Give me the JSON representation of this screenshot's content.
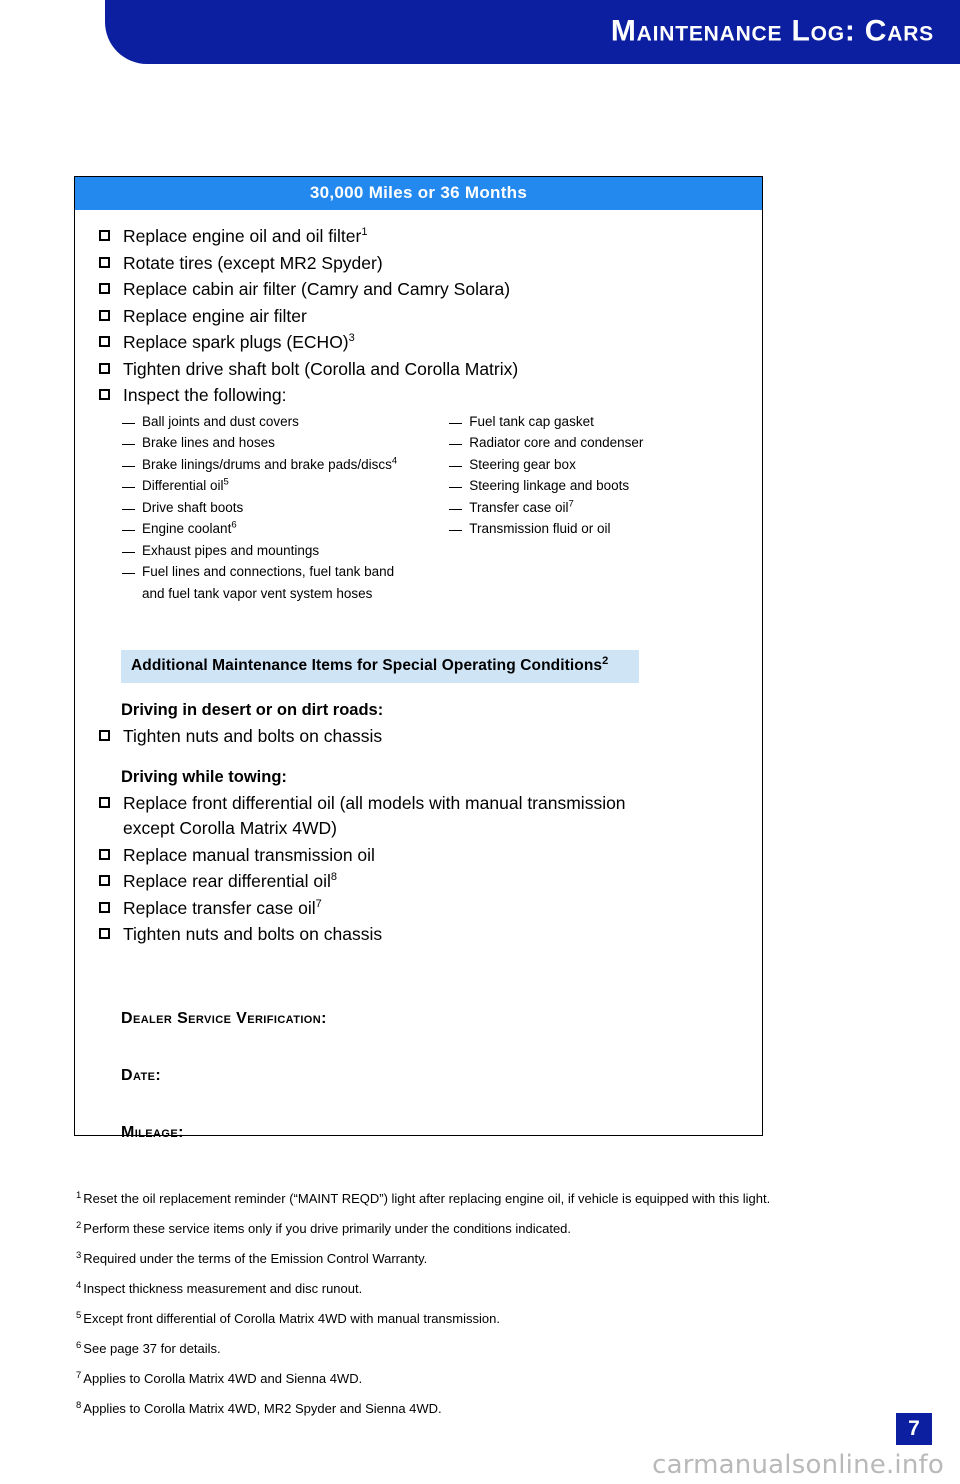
{
  "header": {
    "title": "Maintenance Log: Cars",
    "banner_color": "#0b1fa0"
  },
  "log_table": {
    "header_title": "30,000 Miles or 36 Months",
    "header_color": "#2389ef",
    "items": [
      {
        "label": "Replace engine oil and oil filter",
        "sup": "1"
      },
      {
        "label": "Rotate tires (except MR2 Spyder)",
        "sup": ""
      },
      {
        "label": "Replace cabin air filter (Camry and Camry Solara)",
        "sup": ""
      },
      {
        "label": "Replace engine air filter",
        "sup": ""
      },
      {
        "label": "Replace spark plugs (ECHO)",
        "sup": "3"
      },
      {
        "label": "Tighten drive shaft bolt (Corolla and Corolla Matrix)",
        "sup": ""
      },
      {
        "label": "Inspect the following:",
        "sup": ""
      }
    ],
    "inspect_left": [
      {
        "label": "Ball joints and dust covers",
        "sup": "",
        "cont": ""
      },
      {
        "label": "Brake lines and hoses",
        "sup": "",
        "cont": ""
      },
      {
        "label": "Brake linings/drums and brake pads/discs",
        "sup": "4",
        "cont": ""
      },
      {
        "label": "Differential oil",
        "sup": "5",
        "cont": ""
      },
      {
        "label": "Drive shaft boots",
        "sup": "",
        "cont": ""
      },
      {
        "label": "Engine coolant",
        "sup": "6",
        "cont": ""
      },
      {
        "label": "Exhaust pipes and mountings",
        "sup": "",
        "cont": ""
      },
      {
        "label": "Fuel lines and connections, fuel tank band",
        "sup": "",
        "cont": "and fuel tank vapor vent system hoses"
      }
    ],
    "inspect_right": [
      {
        "label": "Fuel tank cap gasket",
        "sup": "",
        "cont": ""
      },
      {
        "label": "Radiator core and condenser",
        "sup": "",
        "cont": ""
      },
      {
        "label": "Steering gear box",
        "sup": "",
        "cont": ""
      },
      {
        "label": "Steering linkage and boots",
        "sup": "",
        "cont": ""
      },
      {
        "label": "Transfer case oil",
        "sup": "7",
        "cont": ""
      },
      {
        "label": "Transmission fluid or oil",
        "sup": "",
        "cont": ""
      }
    ],
    "special_bar": {
      "label": "Additional Maintenance Items for Special Operating Conditions",
      "sup": "2",
      "background": "#cfe4f5"
    },
    "desert_heading": "Driving in desert or on dirt roads:",
    "desert_items": [
      {
        "label": "Tighten nuts and bolts on chassis",
        "sup": "",
        "cont": ""
      }
    ],
    "towing_heading": "Driving while towing:",
    "towing_items": [
      {
        "label": "Replace front differential oil (all models with manual transmission",
        "sup": "",
        "cont": "except Corolla Matrix 4WD)"
      },
      {
        "label": "Replace manual transmission oil",
        "sup": "",
        "cont": ""
      },
      {
        "label": "Replace rear differential oil",
        "sup": "8",
        "cont": ""
      },
      {
        "label": "Replace transfer case oil",
        "sup": "7",
        "cont": ""
      },
      {
        "label": "Tighten nuts and bolts on chassis",
        "sup": "",
        "cont": ""
      }
    ],
    "verification": {
      "dealer_label": "Dealer Service Verification:",
      "date_label": "Date:",
      "mileage_label": "Mileage:"
    }
  },
  "footnotes": [
    {
      "num": "1",
      "text": "Reset the oil replacement reminder (“MAINT REQD”) light after replacing engine oil, if vehicle is equipped with this light."
    },
    {
      "num": "2",
      "text": "Perform these service items only if you drive primarily under the conditions indicated."
    },
    {
      "num": "3",
      "text": "Required under the terms of the Emission Control Warranty."
    },
    {
      "num": "4",
      "text": "Inspect thickness measurement and disc runout."
    },
    {
      "num": "5",
      "text": "Except front differential of Corolla Matrix 4WD with manual transmission."
    },
    {
      "num": "6",
      "text": "See page 37 for details."
    },
    {
      "num": "7",
      "text": "Applies to Corolla Matrix 4WD and Sienna 4WD."
    },
    {
      "num": "8",
      "text": "Applies to Corolla Matrix 4WD, MR2 Spyder and Sienna 4WD."
    }
  ],
  "footer": {
    "page_number": "7",
    "watermark": "carmanualsonline.info"
  }
}
